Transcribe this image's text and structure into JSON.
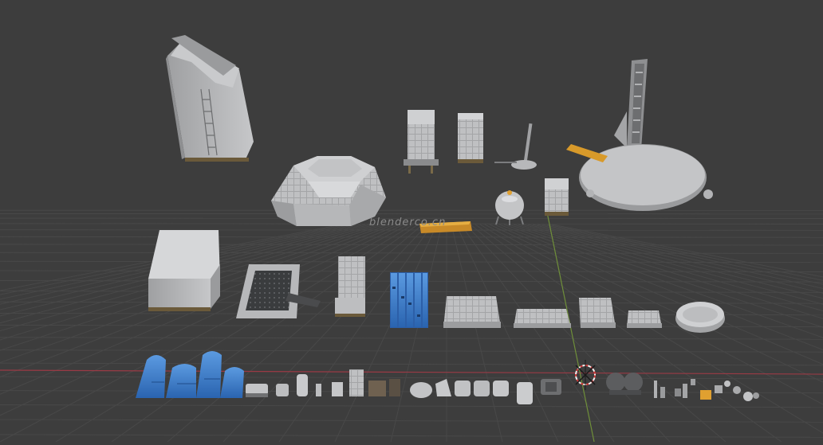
{
  "viewport": {
    "background": "#3d3d3d",
    "grid_color": "#4a4a4a",
    "x_axis_color": "#9a3a45",
    "y_axis_color": "#6f8f3a",
    "object_gray": "#b8b9bb",
    "selection_orange": "#e0a030",
    "solar_blue": "#3a7fd0",
    "dome_blue": "#2f6fc4"
  },
  "watermark": "blenderco.cn",
  "objects": [
    {
      "name": "tall-slanted-tower"
    },
    {
      "name": "octagonal-dome-hall"
    },
    {
      "name": "tower-block-on-legs"
    },
    {
      "name": "tower-block-small"
    },
    {
      "name": "antenna-mast"
    },
    {
      "name": "spherical-tank"
    },
    {
      "name": "small-tower-module"
    },
    {
      "name": "launch-pad-with-tower"
    },
    {
      "name": "yellow-plank"
    },
    {
      "name": "orange-ramp"
    },
    {
      "name": "large-box-hangar"
    },
    {
      "name": "flat-platform-with-ramp"
    },
    {
      "name": "module-block"
    },
    {
      "name": "solar-panel-array"
    },
    {
      "name": "ground-plate-large"
    },
    {
      "name": "ground-plate-wide"
    },
    {
      "name": "ground-plate-medium"
    },
    {
      "name": "ground-plate-small"
    },
    {
      "name": "round-disc-platform"
    },
    {
      "name": "blue-greenhouse-tunnels"
    },
    {
      "name": "small-parts-row"
    }
  ],
  "cursor_3d": "3d-cursor-icon"
}
